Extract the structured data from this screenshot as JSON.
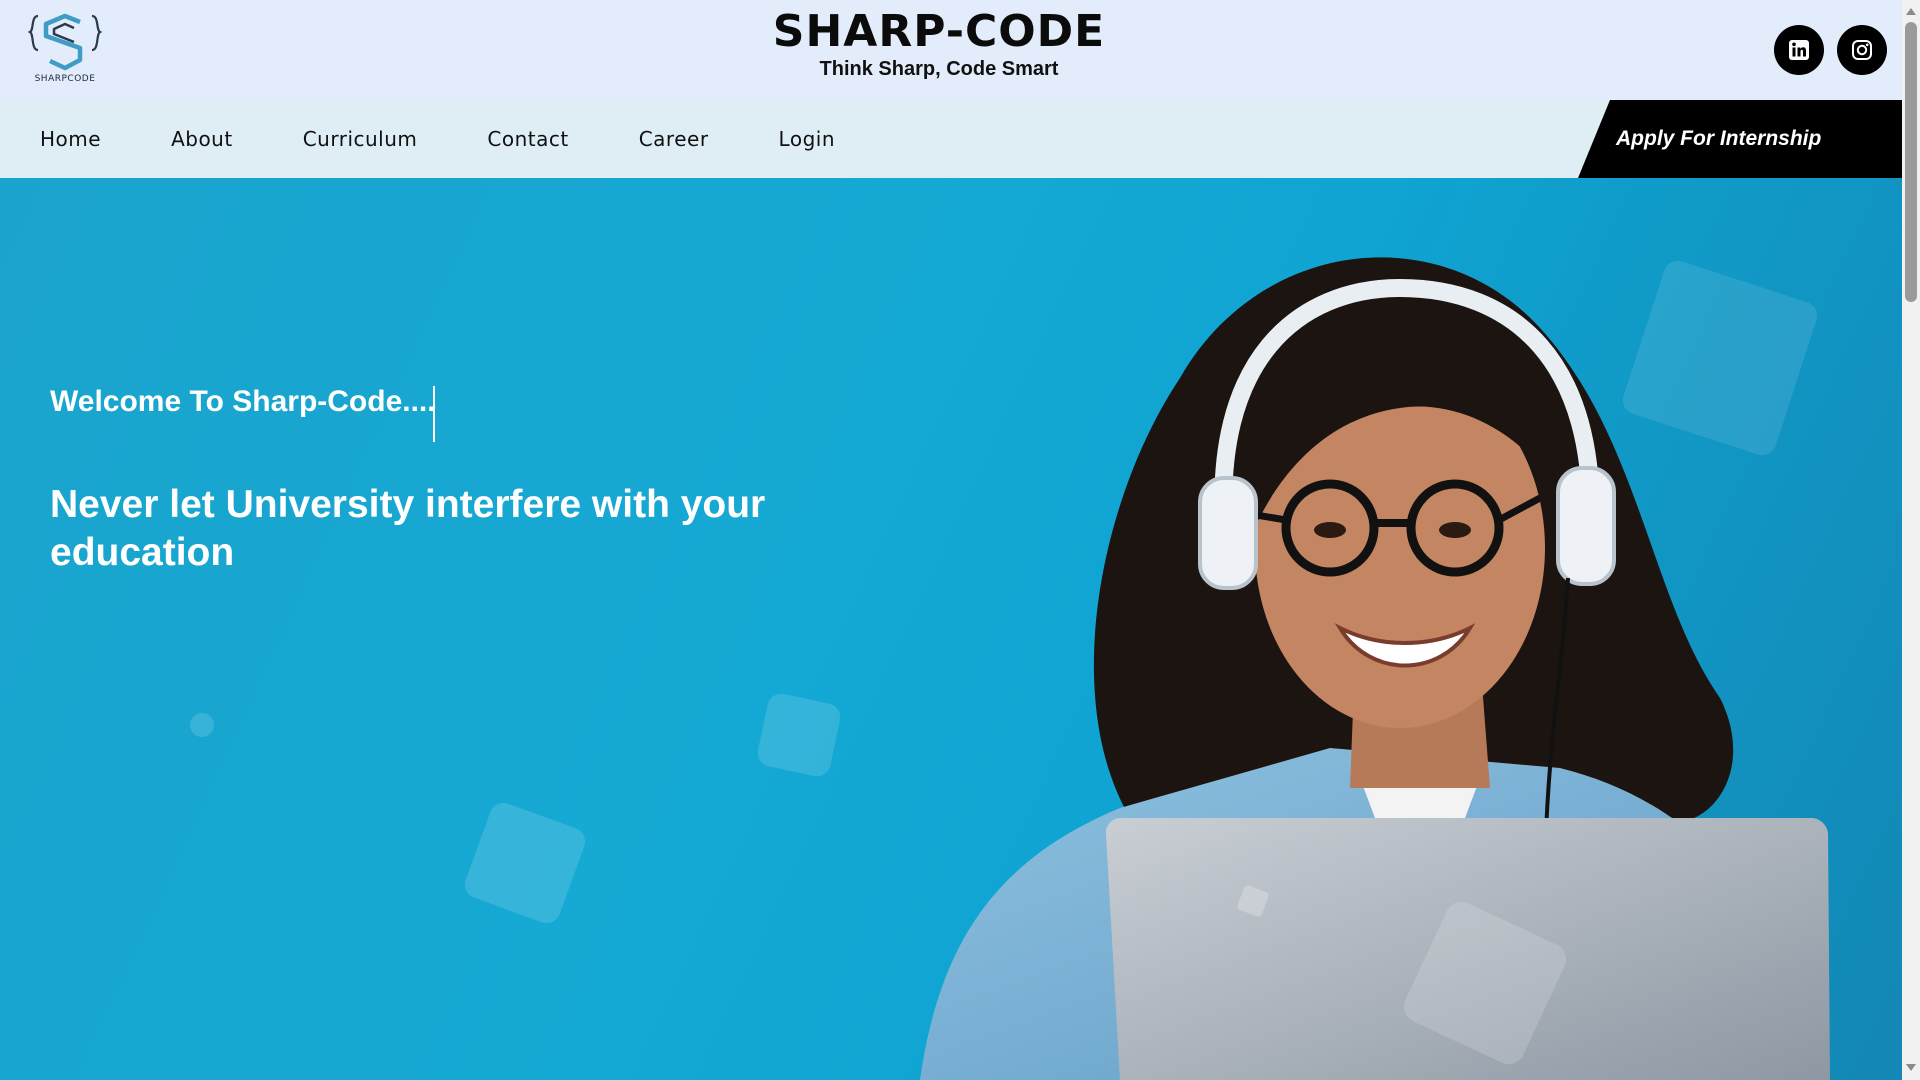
{
  "header": {
    "logo_text": "SHARPCODE",
    "title": "SHARP-CODE",
    "tagline": "Think Sharp, Code Smart",
    "social": [
      {
        "name": "LinkedIn",
        "icon": "linkedin-icon"
      },
      {
        "name": "Instagram",
        "icon": "instagram-icon"
      }
    ]
  },
  "nav": {
    "items": [
      {
        "label": "Home"
      },
      {
        "label": "About"
      },
      {
        "label": "Curriculum"
      },
      {
        "label": "Contact"
      },
      {
        "label": "Career"
      },
      {
        "label": "Login"
      }
    ],
    "cta_label": "Apply For Internship"
  },
  "hero": {
    "welcome": "Welcome To Sharp-Code....",
    "headline": "Never let University interfere with your education",
    "image": "smiling student with headphones and glasses using a laptop"
  },
  "colors": {
    "header_bg": "#e3ecfb",
    "nav_bg": "#dfeef5",
    "hero_bg": "#15a9d4",
    "cta_bg": "#000000",
    "text_dark": "#111111"
  }
}
